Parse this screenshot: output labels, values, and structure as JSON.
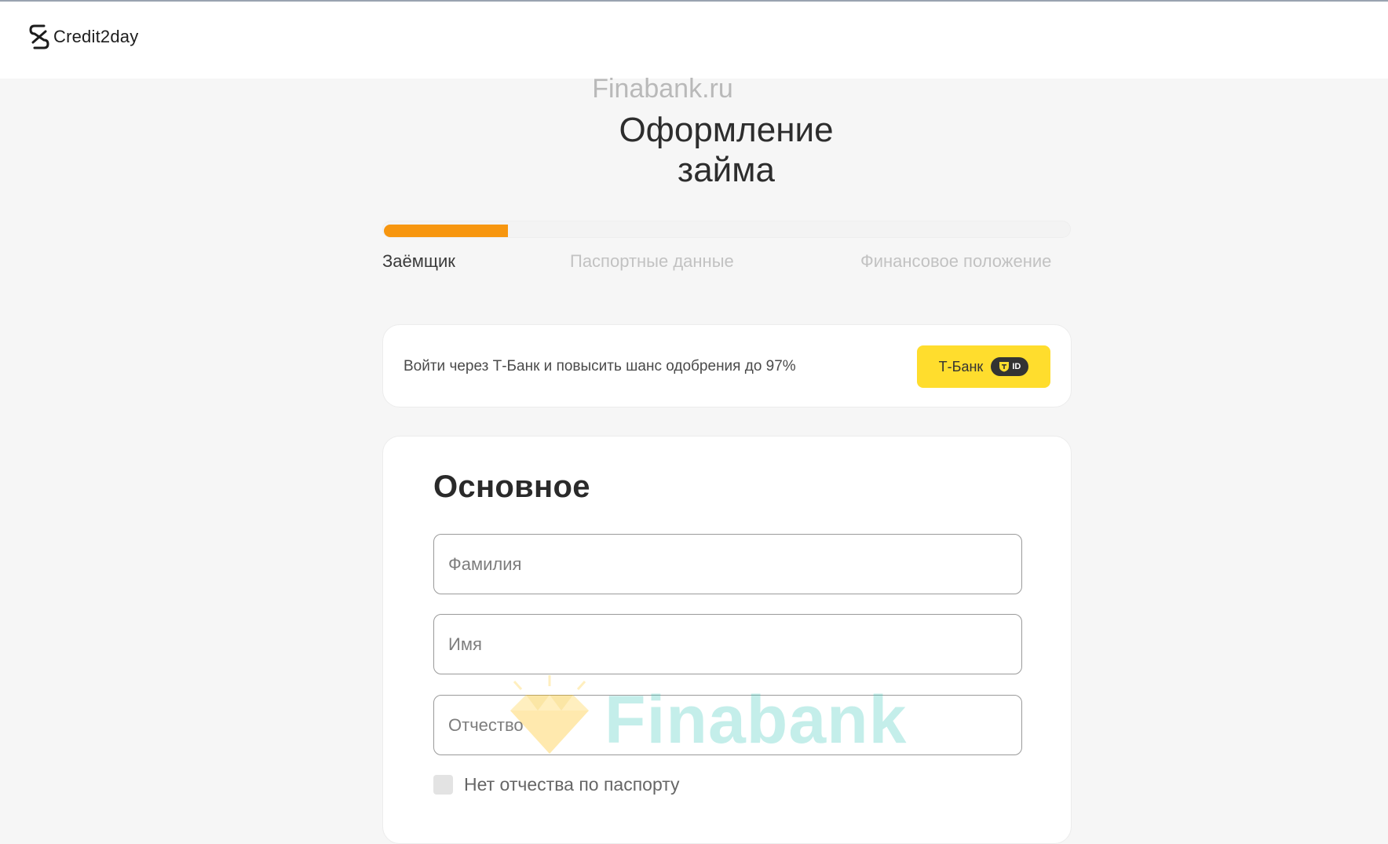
{
  "header": {
    "logo_text": "Credit2day",
    "logo_icon": "credit2day-s-icon"
  },
  "watermark_top": "Finabank.ru",
  "page_title": {
    "line1": "Оформление",
    "line2": "займа"
  },
  "progress": {
    "fraction": 0.18,
    "steps": [
      {
        "label": "Заёмщик",
        "active": true
      },
      {
        "label": "Паспортные данные",
        "active": false
      },
      {
        "label": "Финансовое положение",
        "active": false
      }
    ],
    "fill_color": "#f7960f"
  },
  "tbank": {
    "text": "Войти через Т-Банк и повысить шанс одобрения до 97%",
    "button_label": "Т-Банк",
    "badge": "ID",
    "button_color": "#ffdd2d"
  },
  "form": {
    "section_title": "Основное",
    "fields": [
      {
        "placeholder": "Фамилия"
      },
      {
        "placeholder": "Имя"
      },
      {
        "placeholder": "Отчество"
      }
    ],
    "no_patronymic_label": "Нет отчества по паспорту"
  },
  "watermark_big": "Finabank"
}
